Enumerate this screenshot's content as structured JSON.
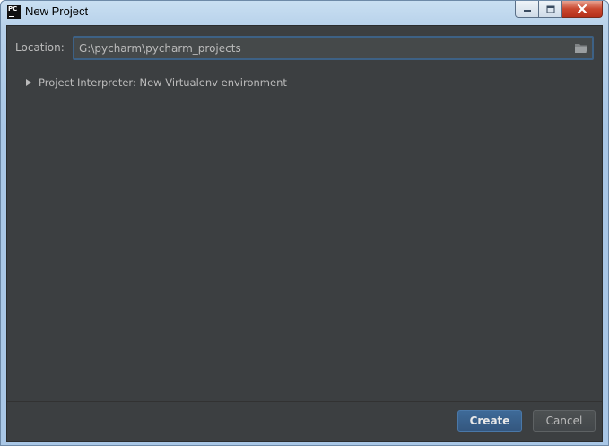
{
  "window": {
    "title": "New Project",
    "app_icon_text": "PC"
  },
  "location": {
    "label": "Location:",
    "value": "G:\\pycharm\\pycharm_projects"
  },
  "interpreter": {
    "label": "Project Interpreter: New Virtualenv environment",
    "expanded": false
  },
  "buttons": {
    "create_label": "Create",
    "cancel_label": "Cancel"
  },
  "colors": {
    "dialog_bg": "#3c3f41",
    "accent": "#3d6185",
    "text": "#bbbbbb"
  }
}
